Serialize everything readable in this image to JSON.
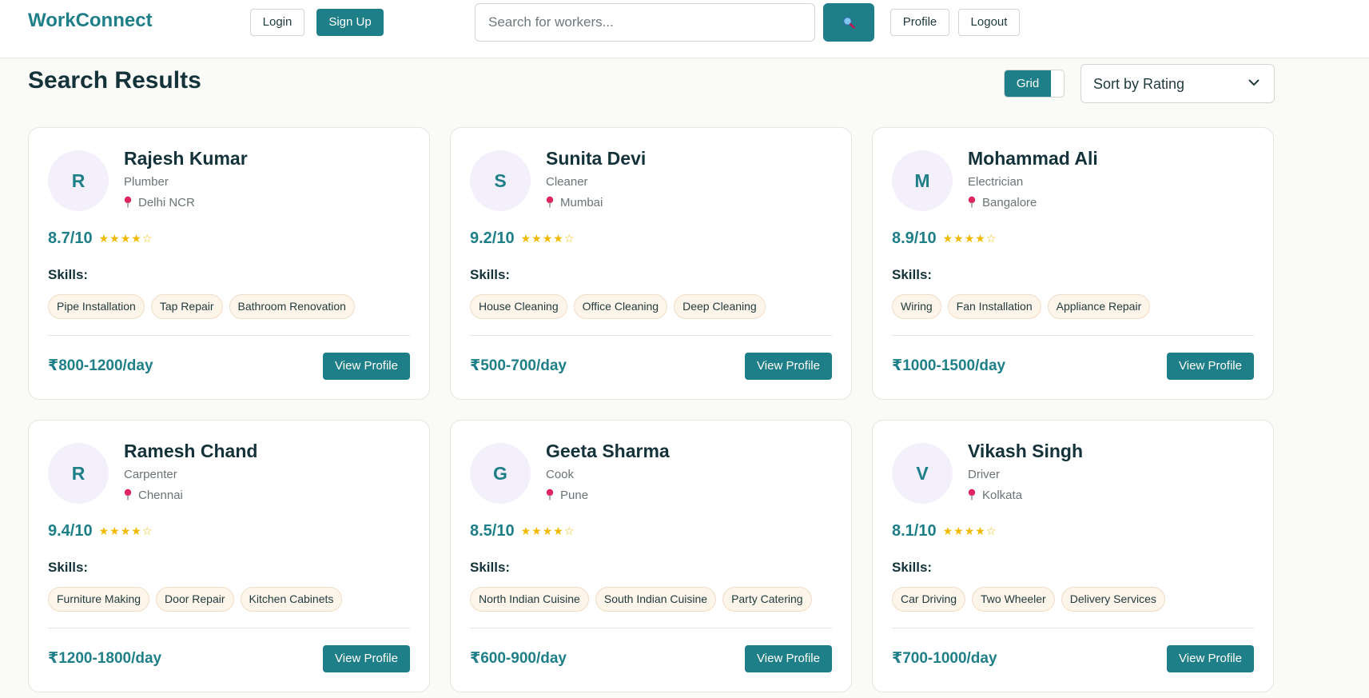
{
  "header": {
    "brand": "WorkConnect",
    "login_label": "Login",
    "signup_label": "Sign Up",
    "search_placeholder": "Search for workers...",
    "profile_label": "Profile",
    "logout_label": "Logout"
  },
  "main": {
    "title": "Search Results",
    "view_toggle": {
      "grid_label": "Grid"
    },
    "sort": {
      "selected": "Sort by Rating"
    },
    "skills_label": "Skills:",
    "view_profile_label": "View Profile",
    "workers": [
      {
        "initial": "R",
        "name": "Rajesh Kumar",
        "role": "Plumber",
        "location": "Delhi NCR",
        "rating": "8.7/10",
        "stars": "★★★★☆",
        "skills": [
          "Pipe Installation",
          "Tap Repair",
          "Bathroom Renovation"
        ],
        "price": "₹800-1200/day"
      },
      {
        "initial": "S",
        "name": "Sunita Devi",
        "role": "Cleaner",
        "location": "Mumbai",
        "rating": "9.2/10",
        "stars": "★★★★☆",
        "skills": [
          "House Cleaning",
          "Office Cleaning",
          "Deep Cleaning"
        ],
        "price": "₹500-700/day"
      },
      {
        "initial": "M",
        "name": "Mohammad Ali",
        "role": "Electrician",
        "location": "Bangalore",
        "rating": "8.9/10",
        "stars": "★★★★☆",
        "skills": [
          "Wiring",
          "Fan Installation",
          "Appliance Repair"
        ],
        "price": "₹1000-1500/day"
      },
      {
        "initial": "R",
        "name": "Ramesh Chand",
        "role": "Carpenter",
        "location": "Chennai",
        "rating": "9.4/10",
        "stars": "★★★★☆",
        "skills": [
          "Furniture Making",
          "Door Repair",
          "Kitchen Cabinets"
        ],
        "price": "₹1200-1800/day"
      },
      {
        "initial": "G",
        "name": "Geeta Sharma",
        "role": "Cook",
        "location": "Pune",
        "rating": "8.5/10",
        "stars": "★★★★☆",
        "skills": [
          "North Indian Cuisine",
          "South Indian Cuisine",
          "Party Catering"
        ],
        "price": "₹600-900/day"
      },
      {
        "initial": "V",
        "name": "Vikash Singh",
        "role": "Driver",
        "location": "Kolkata",
        "rating": "8.1/10",
        "stars": "★★★★☆",
        "skills": [
          "Car Driving",
          "Two Wheeler",
          "Delivery Services"
        ],
        "price": "₹700-1000/day"
      }
    ]
  },
  "colors": {
    "accent": "#1f7f88",
    "star": "#f2b900",
    "pin": "#e0245e",
    "chip_bg": "#fdf4ea",
    "avatar_bg": "#f3effb"
  }
}
